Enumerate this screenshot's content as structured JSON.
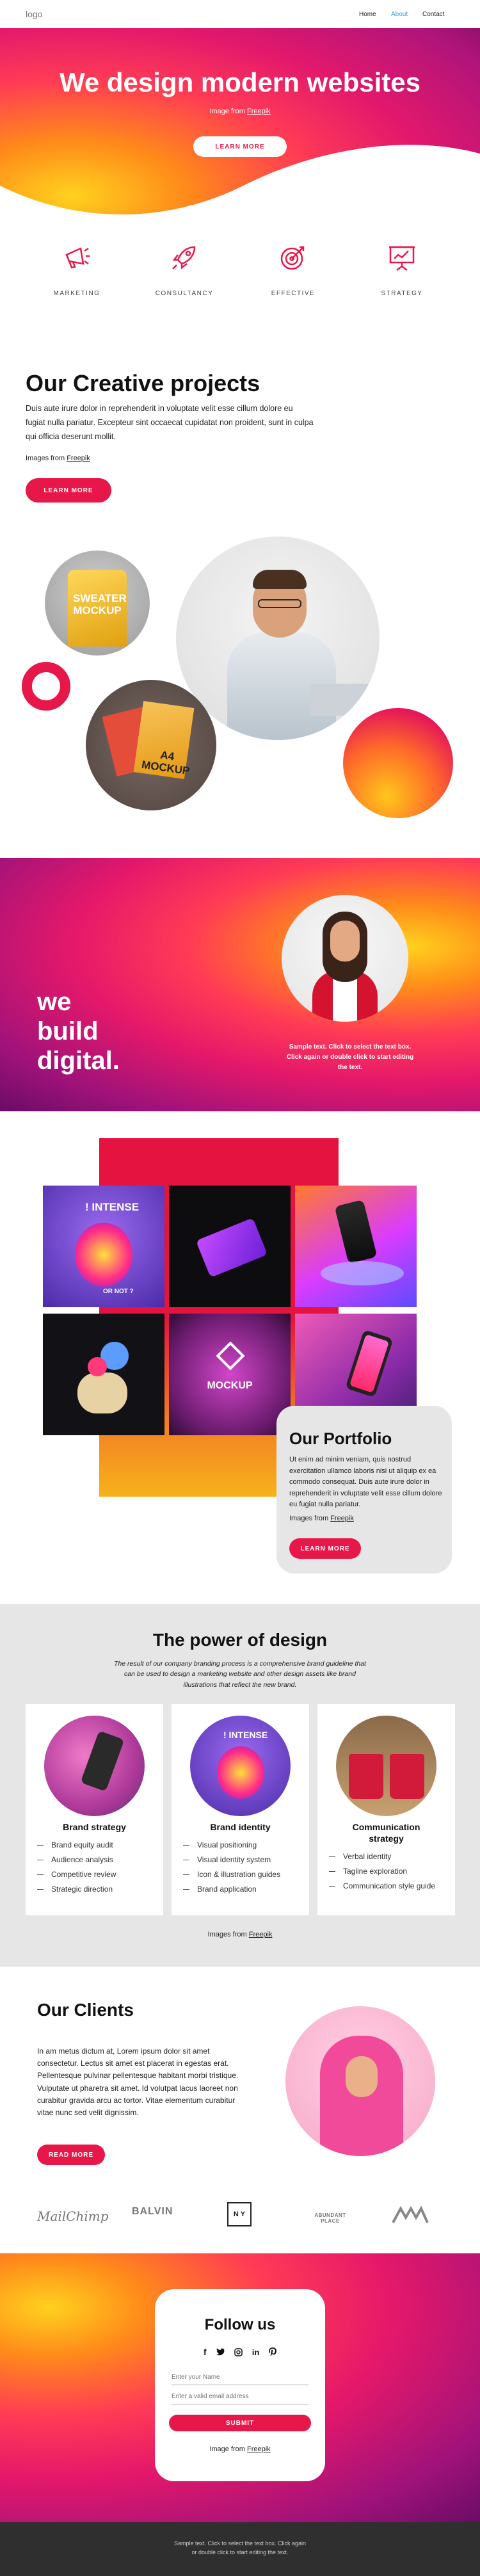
{
  "nav": {
    "logo": "logo",
    "items": [
      {
        "label": "Home"
      },
      {
        "label": "About"
      },
      {
        "label": "Contact"
      }
    ]
  },
  "hero": {
    "title": "We design modern websites",
    "credit_prefix": "Image from ",
    "credit_link": "Freepik",
    "button": "LEARN MORE"
  },
  "features": [
    {
      "label": "MARKETING",
      "icon": "megaphone-icon"
    },
    {
      "label": "CONSULTANCY",
      "icon": "rocket-icon"
    },
    {
      "label": "EFFECTIVE",
      "icon": "target-icon"
    },
    {
      "label": "STRATEGY",
      "icon": "presentation-board-icon"
    }
  ],
  "creative": {
    "title": "Our Creative projects",
    "body": "Duis aute irure dolor in reprehenderit in voluptate velit esse cillum dolore eu fugiat nulla pariatur. Excepteur sint occaecat cupidatat non proident, sunt in culpa qui officia deserunt mollit.",
    "credit_prefix": "Images from ",
    "credit_link": "Freepik",
    "button": "LEARN MORE",
    "sweater_text": "SWEATER MOCKUP",
    "a4_text": "A4 MOCKUP"
  },
  "digital": {
    "line1": "we",
    "line2": "build",
    "line3": "digital.",
    "sample": "Sample text. Click to select the text box. Click again or double click to start editing the text."
  },
  "portfolio": {
    "title": "Our Portfolio",
    "body": "Ut enim ad minim veniam, quis nostrud exercitation ullamco laboris nisi ut aliquip ex ea commodo consequat. Duis aute irure dolor in reprehenderit in voluptate velit esse cillum dolore eu fugiat nulla pariatur.",
    "credit_prefix": "Images from ",
    "credit_link": "Freepik",
    "button": "LEARN MORE",
    "tile_intense": "! INTENSE",
    "tile_ornot": "OR NOT ?",
    "tile_mockup": "MOCKUP"
  },
  "power": {
    "title": "The power of design",
    "intro": "The result of our company branding process is a comprehensive brand guideline that can be used to design a marketing website and other design assets like brand illustrations that reflect the new brand.",
    "cards": [
      {
        "title": "Brand strategy",
        "items": [
          "Brand equity audit",
          "Audience analysis",
          "Competitive review",
          "Strategic direction"
        ]
      },
      {
        "title": "Brand identity",
        "items": [
          "Visual positioning",
          "Visual identity system",
          "Icon & illustration guides",
          "Brand application"
        ]
      },
      {
        "title": "Communication strategy",
        "items": [
          "Verbal identity",
          "Tagline exploration",
          "Communication style guide"
        ]
      }
    ],
    "credit_prefix": "Images from ",
    "credit_link": "Freepik"
  },
  "clients": {
    "title": "Our Clients",
    "body": "In am metus dictum at, Lorem ipsum dolor sit amet consectetur. Lectus sit amet est placerat in egestas erat. Pellentesque pulvinar pellentesque habitant morbi tristique. Vulputate ut pharetra sit amet. Id volutpat lacus laoreet non curabitur gravida arcu ac tortor. Vitae elementum curabitur vitae nunc sed velit dignissim.",
    "button": "READ MORE",
    "logos": [
      "MailChimp",
      "BALVIN",
      "N Y",
      "ABUNDANT PLACE",
      "MM"
    ]
  },
  "follow": {
    "title": "Follow us",
    "name_placeholder": "Enter your Name",
    "email_placeholder": "Enter a valid email address",
    "submit": "SUBMIT",
    "credit_prefix": "Image from ",
    "credit_link": "Freepik"
  },
  "footer": {
    "text": "Sample text. Click to select the text box. Click again or double click to start editing the text."
  },
  "colors": {
    "accent": "#e8174a",
    "portfolio_red": "#e5133f",
    "gray_bg": "#e6e6e6",
    "footer_bg": "#2f2f2f"
  }
}
